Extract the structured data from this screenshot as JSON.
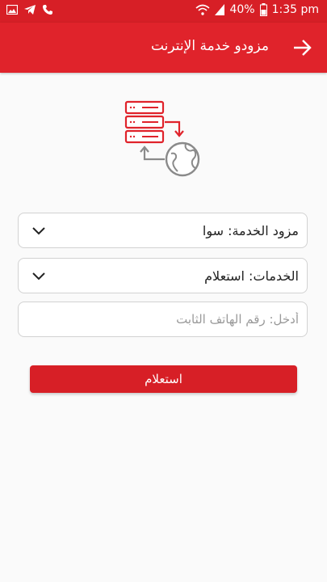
{
  "status_bar": {
    "battery": "40%",
    "time": "1:35 pm",
    "icons": [
      "image-icon",
      "telegram-icon",
      "call-icon",
      "wifi-icon",
      "signal-icon",
      "battery-icon"
    ]
  },
  "app_bar": {
    "title": "مزودو خدمة الإنترنت",
    "back_icon": "arrow-icon"
  },
  "form": {
    "provider": {
      "label": "مزود الخدمة: سوا"
    },
    "service": {
      "label": "الخدمات: استعلام"
    },
    "phone": {
      "placeholder": "أدخل: رقم الهاتف الثابت"
    },
    "submit_label": "استعلام"
  },
  "colors": {
    "primary": "#e0232b",
    "status": "#d71f26",
    "background": "#fafafa"
  }
}
